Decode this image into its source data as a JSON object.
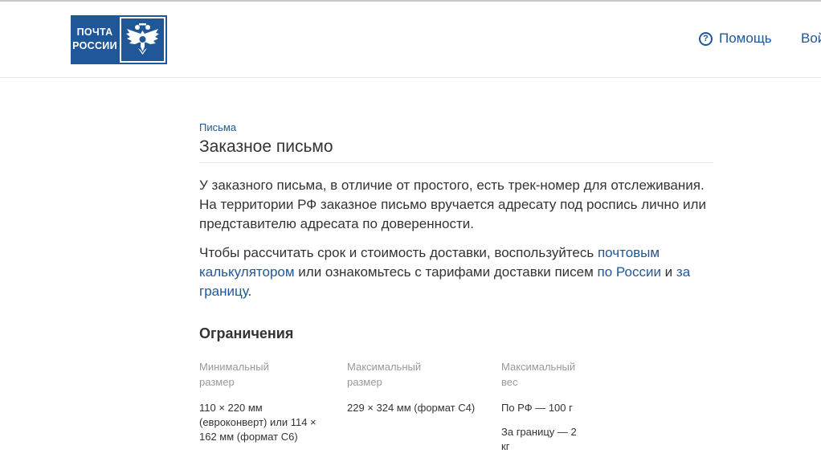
{
  "header": {
    "logo_line1": "ПОЧТА",
    "logo_line2": "РОССИИ",
    "help_label": "Помощь",
    "login_label": "Войти"
  },
  "breadcrumb": "Письма",
  "title": "Заказное письмо",
  "intro": "У заказного письма, в отличие от простого, есть трек-номер для отслеживания. На территории РФ заказное письмо вручается адресату под роспись лично или представителю адресата по доверенности.",
  "calc_para": {
    "text1": "Чтобы рассчитать срок и стоимость доставки, воспользуйтесь ",
    "link_calc": "почтовым калькулятором",
    "text2": " или ознакомьтесь с тарифами доставки писем ",
    "link_russia": "по России",
    "text3": " и ",
    "link_abroad": "за границу",
    "text4": "."
  },
  "limits": {
    "title": "Ограничения",
    "min_size": {
      "label_line1": "Минимальный",
      "label_line2": "размер",
      "value": "110 × 220 мм (евроконверт) или 114 × 162 мм (формат С6)"
    },
    "max_size": {
      "label_line1": "Максимальный",
      "label_line2": "размер",
      "value": "229 × 324 мм (формат С4)"
    },
    "max_weight": {
      "label_line1": "Максимальный",
      "label_line2": "вес",
      "value_rf": "По РФ — 100 г",
      "value_abroad": "За границу — 2 кг"
    }
  },
  "colors": {
    "brand_blue": "#1f5799",
    "text": "#333333",
    "muted": "#999999"
  }
}
